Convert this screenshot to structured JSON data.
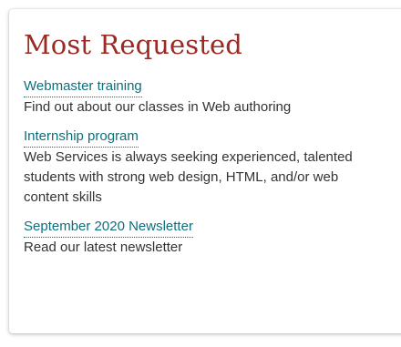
{
  "card": {
    "title": "Most Requested",
    "items": [
      {
        "link": "Webmaster training",
        "description": "Find out about our classes in Web authoring"
      },
      {
        "link": "Internship program",
        "description": "Web Services is always seeking experienced, talented students with strong web design, HTML, and/or web content skills"
      },
      {
        "link": "September 2020 Newsletter",
        "description": "Read our latest newsletter"
      }
    ]
  },
  "colors": {
    "title": "#9b2a23",
    "link": "#0e6f7c",
    "text": "#333333",
    "background": "#ffffff"
  }
}
